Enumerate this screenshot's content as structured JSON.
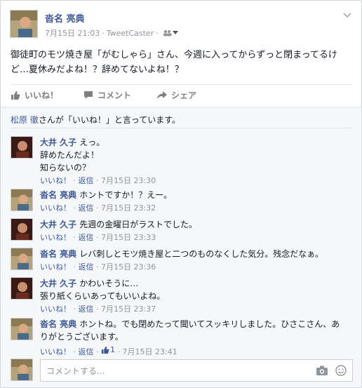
{
  "post": {
    "author": "沓名 亮典",
    "date": "7月15日 21:03",
    "separator": "·",
    "client": "TweetCaster",
    "text": "御徒町のモツ焼き屋「がむしゃら」さん、今週に入ってからずっと閉まってるけど…夏休みだよね！？辞めてないよね！？"
  },
  "actions": {
    "like": "いいね！",
    "comment": "コメント",
    "share": "シェア"
  },
  "likes_line": {
    "name": "松原 徹",
    "suffix": "さんが「いいね！」と言っています。"
  },
  "comments": [
    {
      "author": "大井 久子",
      "lines": [
        "えっ。",
        "辞めたんだよ！",
        "知らないの？"
      ],
      "like": "いいね！",
      "reply": "返信",
      "time": "7月15日 23:30"
    },
    {
      "author": "沓名 亮典",
      "lines": [
        "ホントですか！？えー。"
      ],
      "like": "いいね！",
      "reply": "返信",
      "time": "7月15日 23:32"
    },
    {
      "author": "大井 久子",
      "lines": [
        "先週の金曜日がラストでした。"
      ],
      "like": "いいね！",
      "reply": "返信",
      "time": "7月15日 23:33"
    },
    {
      "author": "沓名 亮典",
      "lines": [
        "レバ刺しとモツ焼き屋と二つのものなくした気分。残念だなぁ。"
      ],
      "like": "いいね！",
      "reply": "返信",
      "time": "7月15日 23:36"
    },
    {
      "author": "大井 久子",
      "lines": [
        "かわいそうに…",
        "張り紙くらいあってもいいよね。"
      ],
      "like": "いいね！",
      "reply": "返信",
      "time": "7月15日 23:37"
    },
    {
      "author": "沓名 亮典",
      "lines": [
        "ホントね。でも閉めたって聞いてスッキリしました。ひさこさん、あ",
        "りがとうございます。"
      ],
      "like": "いいね！",
      "reply": "返信",
      "like_count": "1",
      "time": "7月15日 23:41"
    }
  ],
  "composer": {
    "placeholder": "コメントする..."
  },
  "colors": {
    "link": "#3b5998",
    "meta": "#90949c",
    "background": "#f6f7f9"
  },
  "icons": {
    "post_chevron": "chevron-down-icon",
    "audience": "friends-icon",
    "like": "thumbs-up-icon",
    "comment": "speech-bubble-icon",
    "share": "share-arrow-icon",
    "camera": "camera-icon",
    "emoji": "smiley-icon"
  }
}
